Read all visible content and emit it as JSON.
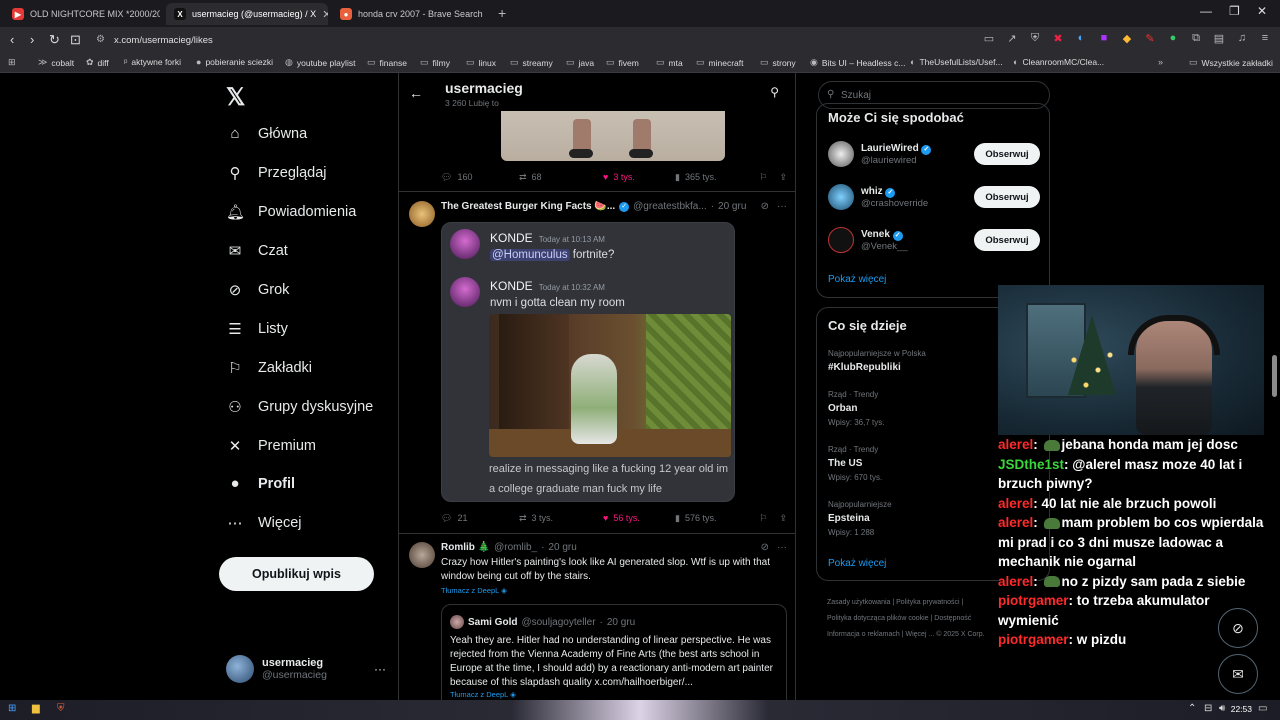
{
  "browser": {
    "tabs": [
      {
        "title": "OLD NIGHTCORE MIX *2000/201",
        "favicon_color": "#e53935"
      },
      {
        "title": "usermacieg (@usermacieg) / X",
        "favicon_color": "#111111"
      },
      {
        "title": "honda crv 2007 - Brave Search",
        "favicon_color": "#e8603c"
      }
    ],
    "url": "x.com/usermacieg/likes",
    "bookmarks": [
      "cobalt",
      "diff",
      "aktywne forki",
      "pobieranie sciezki",
      "youtube playlist",
      "finanse",
      "filmy",
      "linux",
      "streamy",
      "java",
      "fivem",
      "mta",
      "minecraft",
      "strony",
      "Bits UI – Headless c...",
      "TheUsefulLists/Usef...",
      "CleanroomMC/Clea..."
    ],
    "all_bookmarks": "Wszystkie zakładki"
  },
  "nav": {
    "items": [
      {
        "label": "Główna",
        "icon": "home-icon"
      },
      {
        "label": "Przeglądaj",
        "icon": "search-icon"
      },
      {
        "label": "Powiadomienia",
        "icon": "bell-icon"
      },
      {
        "label": "Czat",
        "icon": "mail-icon"
      },
      {
        "label": "Grok",
        "icon": "grok-icon"
      },
      {
        "label": "Listy",
        "icon": "list-icon"
      },
      {
        "label": "Zakładki",
        "icon": "bookmark-icon"
      },
      {
        "label": "Grupy dyskusyjne",
        "icon": "people-icon"
      },
      {
        "label": "Premium",
        "icon": "x-logo-icon"
      },
      {
        "label": "Profil",
        "icon": "person-icon"
      },
      {
        "label": "Więcej",
        "icon": "more-icon"
      }
    ],
    "post_button": "Opublikuj wpis",
    "account": {
      "name": "usermacieg",
      "handle": "@usermacieg"
    }
  },
  "profile_header": {
    "name": "usermacieg",
    "sub": "3 260 Lubię to"
  },
  "tweet1_stats": {
    "replies": "160",
    "reposts": "68",
    "likes": "3 tys.",
    "views": "365 tys."
  },
  "tweet2": {
    "name": "The Greatest Burger King Facts 🍉...",
    "handle": "@greatestbkfa...",
    "time": "20 gru",
    "discord": {
      "msg1": {
        "name": "KONDE",
        "time": "Today at 10:13 AM",
        "mention": "@Homunculus",
        "text": " fortnite?"
      },
      "msg2": {
        "name": "KONDE",
        "time": "Today at 10:32 AM",
        "text": "nvm i gotta clean my room"
      },
      "caption": "realize in messaging like a fucking 12 year old im a college graduate man fuck my life"
    },
    "stats": {
      "replies": "21",
      "reposts": "3 tys.",
      "likes": "56 tys.",
      "views": "576 tys."
    }
  },
  "tweet3": {
    "name": "Romlib 🎄",
    "handle": "@romlib_",
    "time": "20 gru",
    "text": "Crazy how Hitler's painting's look like AI generated slop. Wtf is up with that window being cut off by the stairs.",
    "translate": "Tłumacz z DeepL",
    "quote": {
      "name": "Sami Gold",
      "handle": "@souljagoyteller",
      "time": "20 gru",
      "text": "Yeah they are. Hitler had no understanding of linear perspective. He was rejected from the Vienna Academy of Fine Arts (the best arts school in Europe at the time, I should add) by a reactionary anti-modern art painter because of this slapdash quality  x.com/hailhoerbiger/...",
      "translate": "Tłumacz z DeepL"
    }
  },
  "right": {
    "search_placeholder": "Szukaj",
    "who_title": "Może Ci się spodobać",
    "who": [
      {
        "name": "LaurieWired",
        "handle": "@lauriewired",
        "color": "#cfcfcf"
      },
      {
        "name": "whiz",
        "handle": "@crashoverride",
        "color": "#3a8fb7"
      },
      {
        "name": "Venek",
        "handle": "@Venek__",
        "color": "#1a1a1a"
      }
    ],
    "follow_label": "Obserwuj",
    "show_more": "Pokaż więcej",
    "trends_title": "Co się dzieje",
    "trends": [
      {
        "context": "Najpopularniejsze w Polska",
        "topic": "#KlubRepubliki",
        "count": ""
      },
      {
        "context": "Rząd · Trendy",
        "topic": "Orban",
        "count": "Wpisy: 36,7 tys."
      },
      {
        "context": "Rząd · Trendy",
        "topic": "The US",
        "count": "Wpisy: 670 tys."
      },
      {
        "context": "Najpopularniejsze",
        "topic": "Epsteina",
        "count": "Wpisy: 1 288"
      }
    ],
    "footer": [
      "Zasady użytkowania",
      "Polityka prywatności",
      "Polityka dotycząca plików cookie",
      "Dostępność",
      "Informacja o reklamach",
      "Więcej ...",
      "© 2025 X Corp."
    ]
  },
  "chat": [
    {
      "user": "alerel",
      "color": "#ff2a2a",
      "emote": true,
      "text": "jebana honda mam jej dosc"
    },
    {
      "user": "JSDthe1st",
      "color": "#3ad63a",
      "emote": false,
      "text": "@alerel masz moze 40 lat i brzuch piwny?"
    },
    {
      "user": "alerel",
      "color": "#ff2a2a",
      "emote": false,
      "text": "40 lat nie ale brzuch powoli"
    },
    {
      "user": "alerel",
      "color": "#ff2a2a",
      "emote": true,
      "text": "mam problem bo cos wpierdala mi prad i co 3 dni musze ladowac a mechanik nie ogarnal"
    },
    {
      "user": "alerel",
      "color": "#ff2a2a",
      "emote": true,
      "text": "no z pizdy sam pada z siebie"
    },
    {
      "user": "piotrgamer",
      "color": "#ff2a2a",
      "emote": false,
      "text": "to trzeba akumulator wymienić"
    },
    {
      "user": "piotrgamer",
      "color": "#ff2a2a",
      "emote": false,
      "text": "w pizdu"
    }
  ],
  "taskbar": {
    "time": "22:53"
  }
}
